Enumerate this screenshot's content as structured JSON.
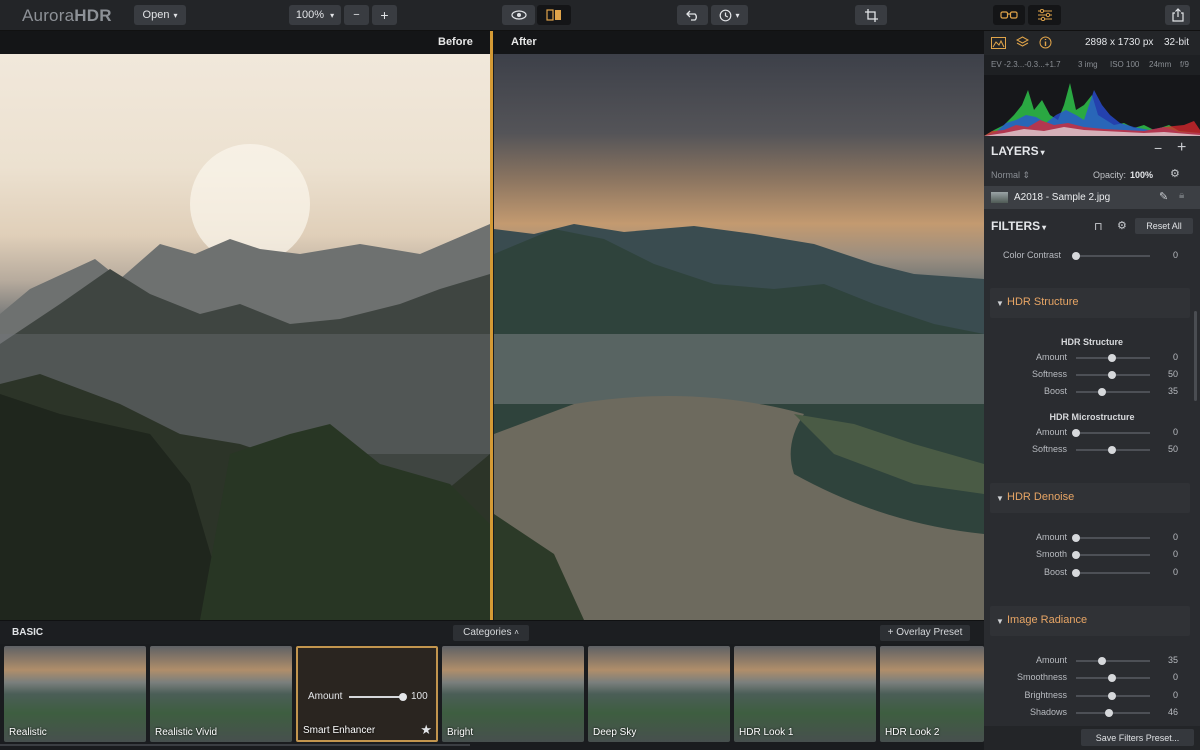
{
  "app": {
    "logo_prefix": "Aurora",
    "logo_suffix": "HDR"
  },
  "toolbar": {
    "open_label": "Open",
    "zoom_value": "100%",
    "minus_label": "−",
    "plus_label": "+",
    "icons": [
      "eye-icon",
      "compare-icon",
      "undo-icon",
      "history-icon",
      "crop-icon",
      "glasses-icon",
      "sliders-icon",
      "share-icon"
    ]
  },
  "compare": {
    "before_label": "Before",
    "after_label": "After"
  },
  "image_info": {
    "size": "2898 x 1730 px",
    "depth": "32-bit"
  },
  "metadata": {
    "ev": "EV  -2.3...-0.3...+1.7",
    "images": "3 img",
    "iso": "ISO 100",
    "focal": "24mm",
    "aperture": "f/9"
  },
  "layers": {
    "title": "LAYERS",
    "blend_mode": "Normal",
    "opacity_label": "Opacity:",
    "opacity_value": "100%",
    "layer_name": "A2018 - Sample 2.jpg"
  },
  "filters": {
    "title": "FILTERS",
    "reset_label": "Reset All",
    "color_contrast": {
      "label": "Color Contrast",
      "value": "0",
      "level": 0.0
    },
    "hdr_structure": {
      "title": "HDR Structure",
      "sub1": "HDR Structure",
      "rows1": [
        {
          "label": "Amount",
          "value": "0",
          "level": 0.5
        },
        {
          "label": "Softness",
          "value": "50",
          "level": 0.5
        },
        {
          "label": "Boost",
          "value": "35",
          "level": 0.35
        }
      ],
      "sub2": "HDR Microstructure",
      "rows2": [
        {
          "label": "Amount",
          "value": "0",
          "level": 0.0
        },
        {
          "label": "Softness",
          "value": "50",
          "level": 0.5
        }
      ]
    },
    "hdr_denoise": {
      "title": "HDR Denoise",
      "rows": [
        {
          "label": "Amount",
          "value": "0",
          "level": 0.0
        },
        {
          "label": "Smooth",
          "value": "0",
          "level": 0.0
        },
        {
          "label": "Boost",
          "value": "0",
          "level": 0.0
        }
      ]
    },
    "image_radiance": {
      "title": "Image Radiance",
      "rows": [
        {
          "label": "Amount",
          "value": "35",
          "level": 0.35
        },
        {
          "label": "Smoothness",
          "value": "0",
          "level": 0.5
        },
        {
          "label": "Brightness",
          "value": "0",
          "level": 0.5
        },
        {
          "label": "Shadows",
          "value": "46",
          "level": 0.46
        }
      ]
    },
    "save_label": "Save Filters Preset..."
  },
  "presets": {
    "group": "BASIC",
    "categories_label": "Categories",
    "overlay_label": "+ Overlay Preset",
    "items": [
      "Realistic",
      "Realistic Vivid",
      "Smart Enhancer",
      "Bright",
      "Deep Sky",
      "HDR Look 1",
      "HDR Look 2"
    ],
    "selected": {
      "amount_label": "Amount",
      "amount_value": "100",
      "level": 1.0
    }
  },
  "colors": {
    "accent": "#d49a35",
    "section_title": "#e7a565"
  }
}
